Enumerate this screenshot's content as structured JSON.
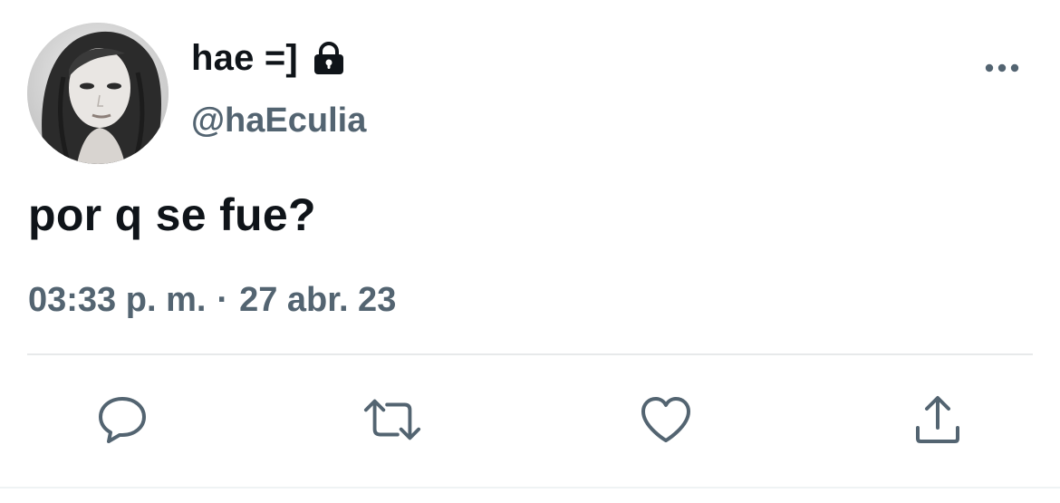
{
  "tweet": {
    "author": {
      "display_name": "hae =]",
      "handle": "@haEculia",
      "protected_icon": "lock-icon",
      "avatar": "avatar-photo"
    },
    "text": "por q se fue?",
    "meta": {
      "time": "03:33 p. m.",
      "separator": "·",
      "date": "27 abr. 23"
    },
    "more_icon": "more-horizontal-icon",
    "actions": [
      {
        "name": "reply",
        "icon": "reply-icon"
      },
      {
        "name": "retweet",
        "icon": "retweet-icon"
      },
      {
        "name": "like",
        "icon": "heart-icon"
      },
      {
        "name": "share",
        "icon": "share-icon"
      }
    ]
  },
  "colors": {
    "text_primary": "#0f1419",
    "text_secondary": "#536471",
    "divider": "#e7e9ea"
  }
}
